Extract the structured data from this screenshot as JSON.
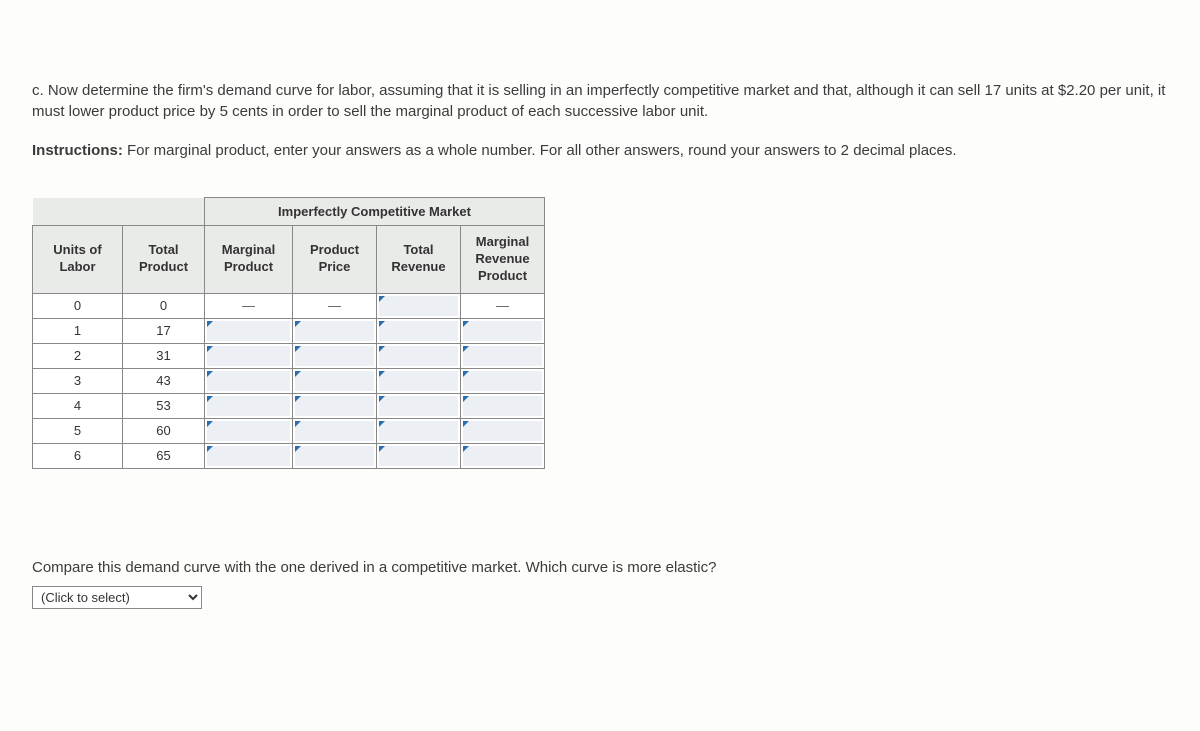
{
  "question": {
    "prefix": "c.",
    "text": "Now determine the firm's demand curve for labor, assuming that it is selling in an imperfectly competitive market and that, although it can sell 17 units at $2.20 per unit, it must lower product price by 5 cents in order to sell the marginal product of each successive labor unit."
  },
  "instructions": {
    "label": "Instructions:",
    "text": "For marginal product, enter your answers as a whole number. For all other answers, round your answers to 2 decimal places."
  },
  "table": {
    "market_header": "Imperfectly Competitive Market",
    "headers": {
      "units": "Units of\nLabor",
      "total_product": "Total\nProduct",
      "marginal_product": "Marginal\nProduct",
      "product_price": "Product\nPrice",
      "total_revenue": "Total\nRevenue",
      "mrp": "Marginal\nRevenue\nProduct"
    },
    "rows": [
      {
        "units": "0",
        "total_product": "0",
        "mp": "—",
        "pp": "—",
        "tr_input": false,
        "mrp": "—"
      },
      {
        "units": "1",
        "total_product": "17",
        "mp_input": true,
        "pp_input": true,
        "tr_input": true,
        "mrp_input": true
      },
      {
        "units": "2",
        "total_product": "31",
        "mp_input": true,
        "pp_input": true,
        "tr_input": true,
        "mrp_input": true
      },
      {
        "units": "3",
        "total_product": "43",
        "mp_input": true,
        "pp_input": true,
        "tr_input": true,
        "mrp_input": true
      },
      {
        "units": "4",
        "total_product": "53",
        "mp_input": true,
        "pp_input": true,
        "tr_input": true,
        "mrp_input": true
      },
      {
        "units": "5",
        "total_product": "60",
        "mp_input": true,
        "pp_input": true,
        "tr_input": true,
        "mrp_input": true
      },
      {
        "units": "6",
        "total_product": "65",
        "mp_input": true,
        "pp_input": true,
        "tr_input": true,
        "mrp_input": true
      }
    ]
  },
  "followup": {
    "text": "Compare this demand curve with the one derived in a competitive market. Which curve is more elastic?",
    "select_placeholder": "(Click to select)"
  }
}
